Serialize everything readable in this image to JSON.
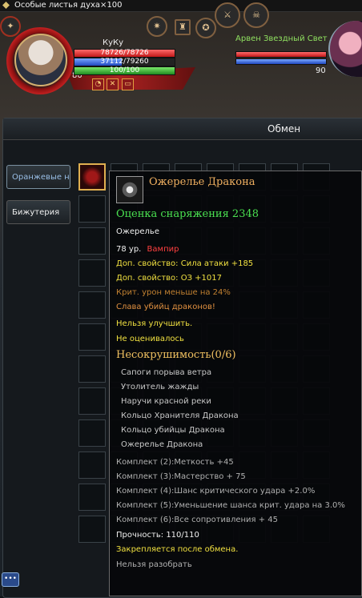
{
  "topbar": {
    "text": "Особые листья духа×100"
  },
  "player": {
    "name": "КуКу",
    "level": "80",
    "hp": "78726/78726",
    "mp": "37112/79260",
    "xp": "100/100"
  },
  "buffs": [
    {
      "icon": "fire-buff-icon"
    },
    {
      "icon": "spiked-buff-icon"
    },
    {
      "icon": "mask-buff-icon"
    },
    {
      "icon": "sword-buff-icon"
    }
  ],
  "target": {
    "name": "Арвен Звездный Свет",
    "level": "90"
  },
  "window": {
    "title": "Обмен"
  },
  "categories": [
    {
      "label": "Оранжевые наручи"
    },
    {
      "label": "Бижутерия"
    }
  ],
  "tooltip": {
    "item_name": "Ожерелье Дракона",
    "score": "Оценка снаряжения 2348",
    "type": "Ожерелье",
    "level": "78 ур.",
    "class": "Вампир",
    "bonus1": "Доп. свойство: Сила атаки +185",
    "bonus2": "Доп. свойство: ОЗ +1017",
    "crit": "Крит. урон меньше на 24%",
    "glory": "Слава убийц драконов!",
    "no_upgrade": "Нельзя улучшить.",
    "no_eval": "Не оценивалось",
    "set_name": "Несокрушимость(0/6)",
    "set_items": [
      "Сапоги порыва ветра",
      "Утолитель жажды",
      "Наручи красной реки",
      "Кольцо Хранителя Дракона",
      "Кольцо убийцы Дракона",
      "Ожерелье Дракона"
    ],
    "set_bonuses": [
      "Комплект (2):Меткость +45",
      "Комплект (3):Мастерство + 75",
      "Комплект (4):Шанс критического удара +2.0%",
      "Комплект (5):Уменьшение шанса крит. удара на 3.0%",
      "Комплект (6):Все сопротивления + 45"
    ],
    "durability": "Прочность: 110/110",
    "bind": "Закрепляется после обмена.",
    "no_dismantle": "Нельзя разобрать"
  },
  "colors": {
    "score": "#4ae050",
    "item_name": "#f0b060",
    "class": "#ff4040",
    "yellow": "#f0e040"
  }
}
